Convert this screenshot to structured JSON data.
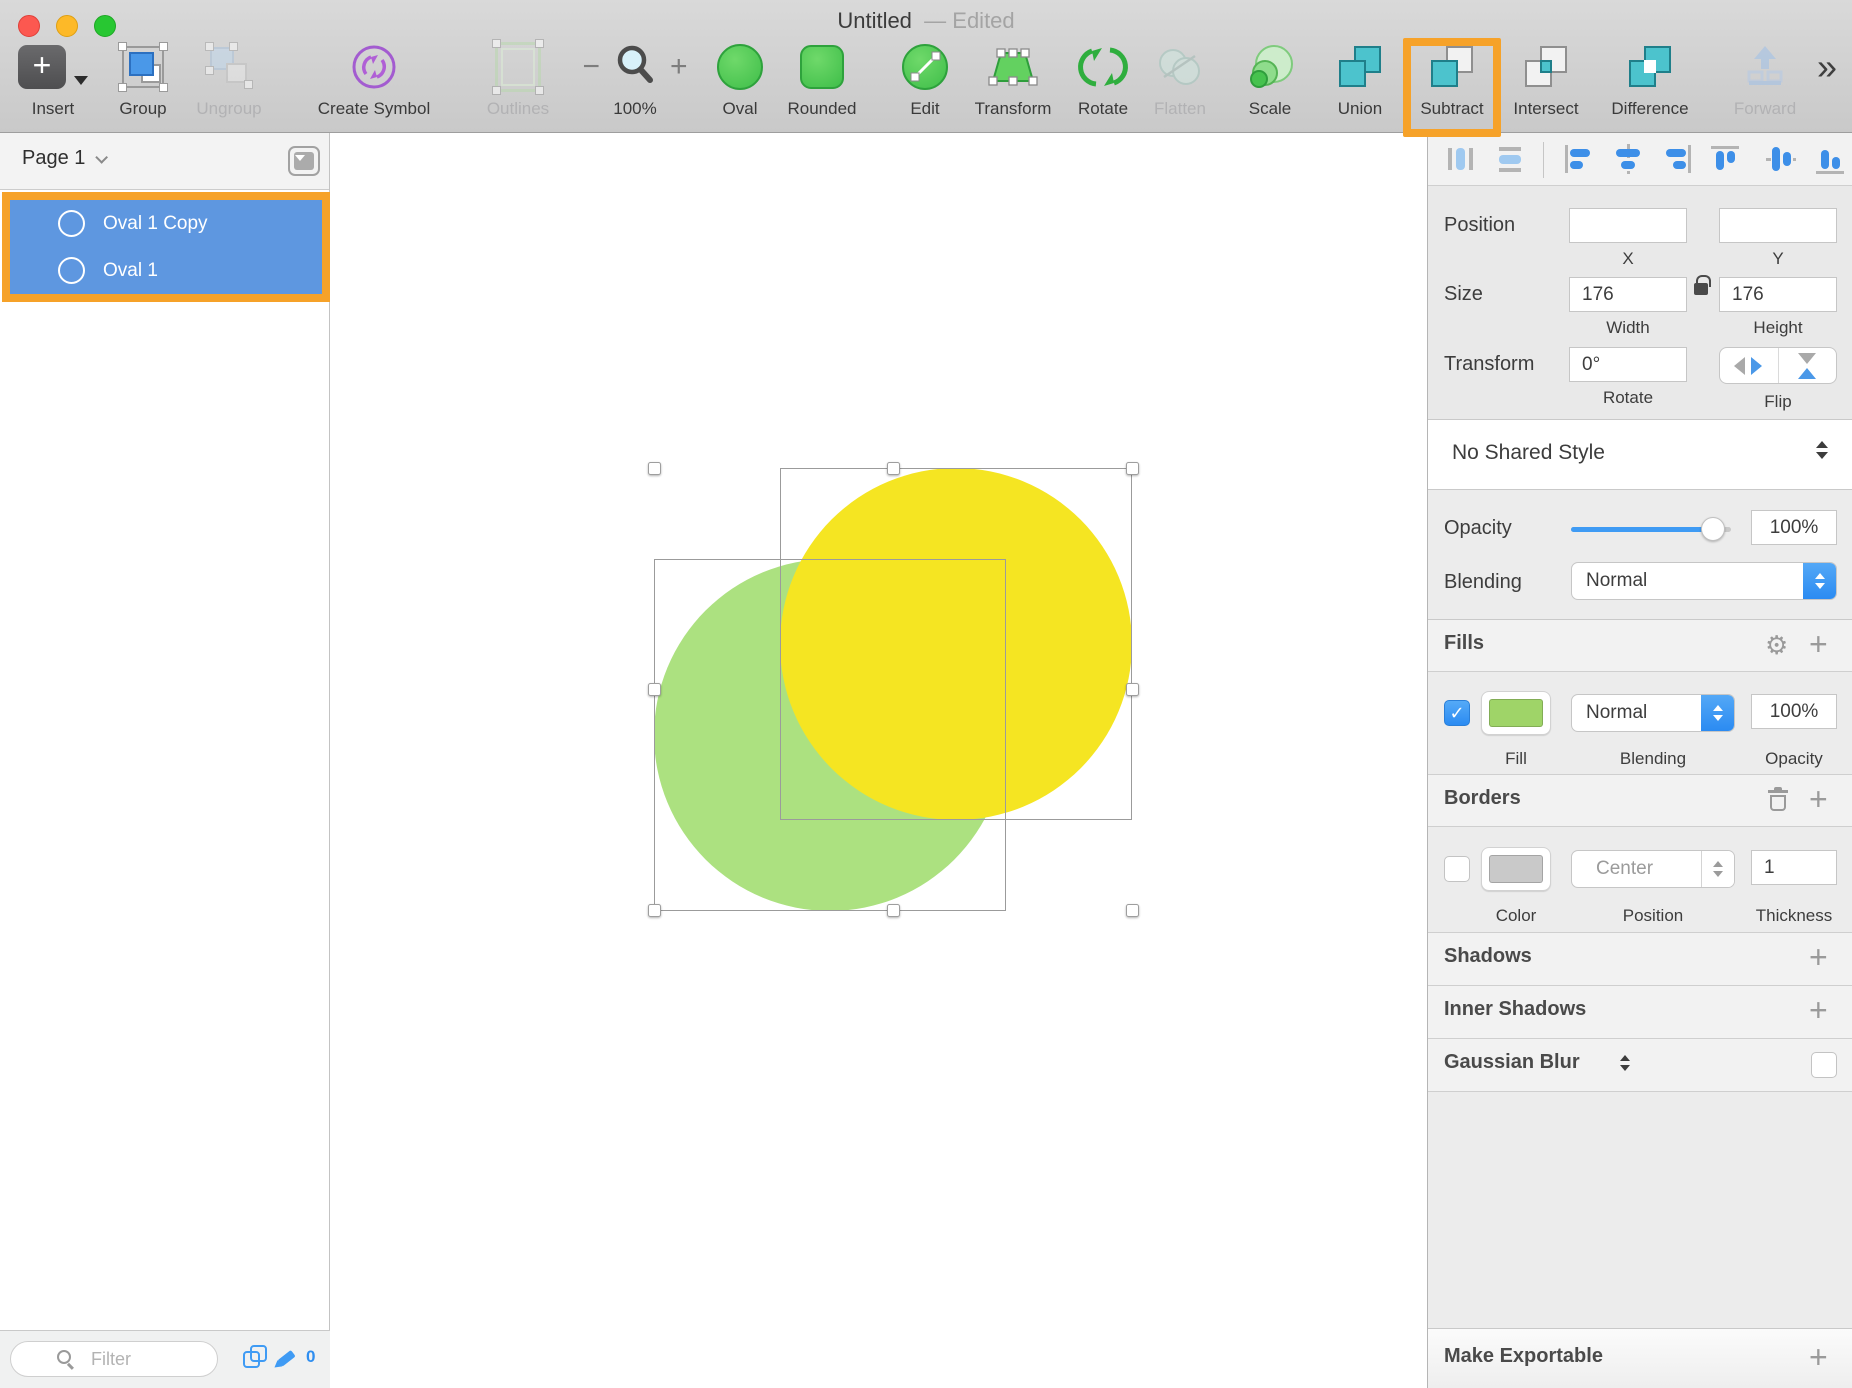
{
  "window": {
    "title": "Untitled",
    "edited": "—  Edited"
  },
  "toolbar": {
    "items": [
      {
        "label": "Insert"
      },
      {
        "label": "Group"
      },
      {
        "label": "Ungroup"
      },
      {
        "label": "Create Symbol"
      },
      {
        "label": "Outlines"
      },
      {
        "label": "100%"
      },
      {
        "label": "Oval"
      },
      {
        "label": "Rounded"
      },
      {
        "label": "Edit"
      },
      {
        "label": "Transform"
      },
      {
        "label": "Rotate"
      },
      {
        "label": "Flatten"
      },
      {
        "label": "Scale"
      },
      {
        "label": "Union"
      },
      {
        "label": "Subtract"
      },
      {
        "label": "Intersect"
      },
      {
        "label": "Difference"
      },
      {
        "label": "Forward"
      }
    ],
    "overflow": "»"
  },
  "sidebar": {
    "page_title": "Page 1",
    "layers": [
      {
        "name": "Oval 1 Copy"
      },
      {
        "name": "Oval 1"
      }
    ],
    "filter_placeholder": "Filter",
    "pencil_count": "0"
  },
  "inspector": {
    "position": {
      "label": "Position",
      "x_label": "X",
      "y_label": "Y",
      "x_value": "",
      "y_value": ""
    },
    "size": {
      "label": "Size",
      "width": "176",
      "height": "176",
      "width_label": "Width",
      "height_label": "Height"
    },
    "transform": {
      "label": "Transform",
      "rotate": "0°",
      "rotate_label": "Rotate",
      "flip_label": "Flip"
    },
    "style": {
      "shared_style": "No Shared Style",
      "opacity_label": "Opacity",
      "opacity": "100%",
      "blending_label": "Blending",
      "blending": "Normal"
    },
    "fills": {
      "header": "Fills",
      "fill_label": "Fill",
      "blending_label": "Blending",
      "blending": "Normal",
      "opacity_label": "Opacity",
      "opacity": "100%",
      "swatch_color": "#9FD468"
    },
    "borders": {
      "header": "Borders",
      "color_label": "Color",
      "position_label": "Position",
      "position": "Center",
      "thickness_label": "Thickness",
      "thickness": "1",
      "swatch_color": "#C9C9C9"
    },
    "shadows_header": "Shadows",
    "inner_shadows_header": "Inner Shadows",
    "gaussian_blur_header": "Gaussian Blur",
    "make_exportable_header": "Make Exportable"
  },
  "canvas": {
    "shapes": [
      {
        "name": "Oval 1",
        "fill": "#ACE180"
      },
      {
        "name": "Oval 1 Copy",
        "fill": "#F5E522"
      }
    ]
  },
  "annotations": {
    "highlight_color": "#F6A229"
  }
}
